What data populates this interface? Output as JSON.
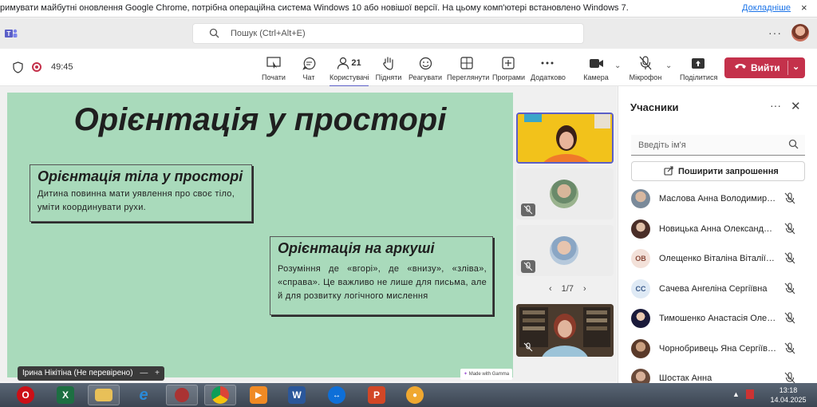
{
  "notification": {
    "message": "римувати майбутні оновлення Google Chrome, потрібна операційна система Windows 10 або новішої версії. На цьому комп'ютері встановлено Windows 7.",
    "link": "Докладніше",
    "close": "×"
  },
  "titlebar": {
    "search_placeholder": "Пошук (Ctrl+Alt+E)",
    "more": "···"
  },
  "toolbar": {
    "timer": "49:45",
    "tools": [
      {
        "label": "Почати",
        "icon": "start-icon"
      },
      {
        "label": "Чат",
        "icon": "chat-icon"
      },
      {
        "label": "Користувачі",
        "icon": "people-icon",
        "count": "21"
      },
      {
        "label": "Підняти",
        "icon": "raise-hand-icon"
      },
      {
        "label": "Реагувати",
        "icon": "react-icon"
      },
      {
        "label": "Переглянути",
        "icon": "view-icon"
      },
      {
        "label": "Програми",
        "icon": "apps-icon"
      },
      {
        "label": "Додатково",
        "icon": "more-icon"
      },
      {
        "label": "Камера",
        "icon": "camera-icon"
      },
      {
        "label": "Мікрофон",
        "icon": "mic-off-icon"
      },
      {
        "label": "Поділитися",
        "icon": "share-icon"
      }
    ],
    "leave_label": "Вийти",
    "accent": "#5b5fc7",
    "leave_color": "#c4314b"
  },
  "slide": {
    "title": "Орієнтація у просторі",
    "card1_title": "Орієнтація тіла у просторі",
    "card1_text": "Дитина повинна мати уявлення про своє тіло, уміти координувати рухи.",
    "card2_title": "Орієнтація на аркуші",
    "card2_text": "Розуміння де «вгорі», де «внизу», «зліва», «справа». Це важливо не лише для письма, але й для розвитку логічного мислення",
    "presenter": "Ірина Нікітіна (Не перевірено)",
    "badge": "Made with Gamma",
    "background": "#a9dabb"
  },
  "video": {
    "pager": "1/7"
  },
  "panel": {
    "title": "Учасники",
    "search_placeholder": "Введіть ім'я",
    "share_label": "Поширити запрошення",
    "participants": [
      {
        "name": "Маслова Анна Володимирівна",
        "initials": ""
      },
      {
        "name": "Новицька Анна Олександрівна",
        "initials": ""
      },
      {
        "name": "Олещенко Віталіна Віталіївна",
        "initials": "ОВ"
      },
      {
        "name": "Сачева Ангеліна Сергіївна",
        "initials": "СС"
      },
      {
        "name": "Тимошенко Анастасія Олександрівна",
        "initials": ""
      },
      {
        "name": "Чорнобривець Яна Сергіївна",
        "initials": ""
      },
      {
        "name": "Шостак Анна",
        "initials": ""
      }
    ]
  },
  "taskbar": {
    "time": "13:18",
    "date": "14.04.2025"
  }
}
